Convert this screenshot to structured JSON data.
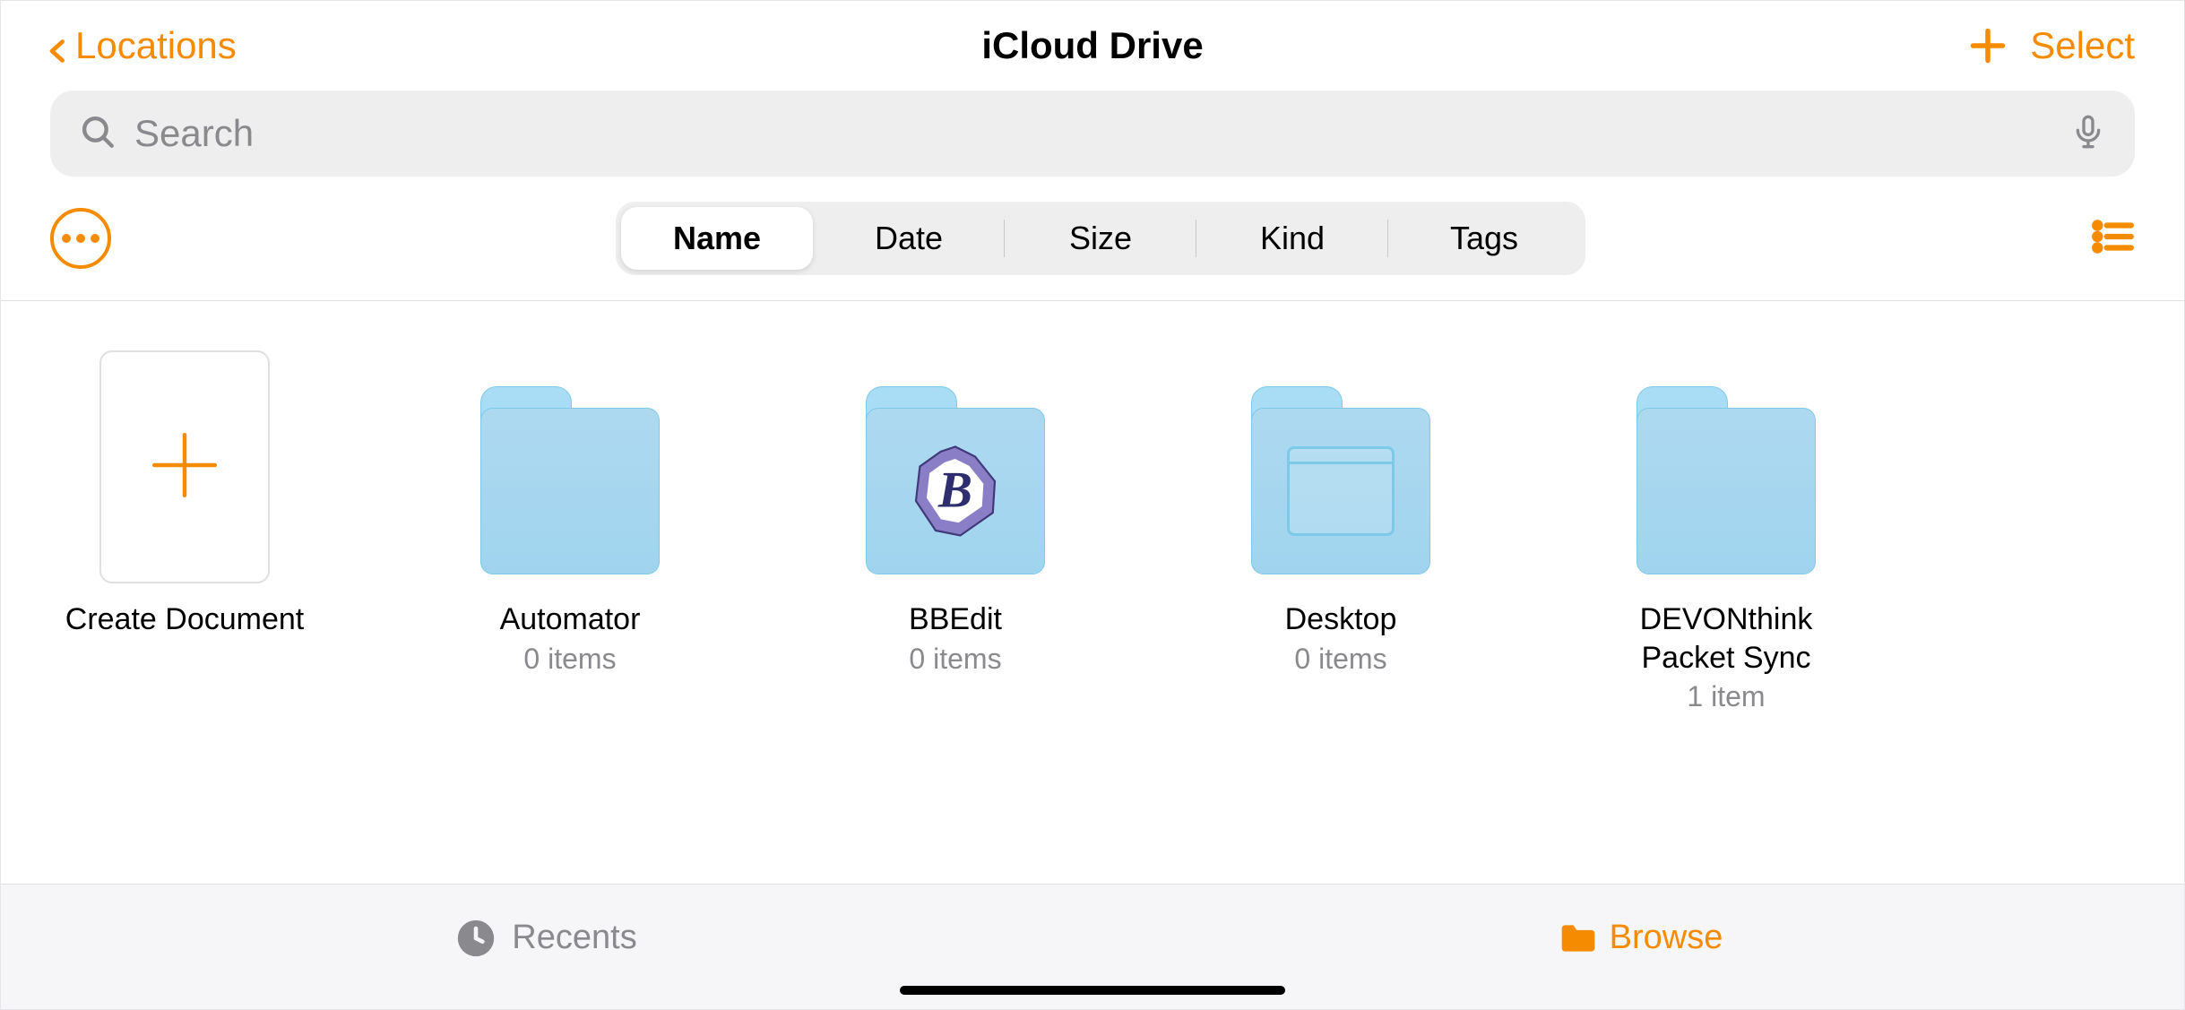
{
  "header": {
    "back_label": "Locations",
    "title": "iCloud Drive",
    "select_label": "Select"
  },
  "search": {
    "placeholder": "Search"
  },
  "sort_segments": [
    "Name",
    "Date",
    "Size",
    "Kind",
    "Tags"
  ],
  "sort_active_index": 0,
  "grid": {
    "create_label": "Create Document",
    "items": [
      {
        "name": "Automator",
        "subtitle": "0 items",
        "overlay": null
      },
      {
        "name": "BBEdit",
        "subtitle": "0 items",
        "overlay": "B"
      },
      {
        "name": "Desktop",
        "subtitle": "0 items",
        "overlay": "window"
      },
      {
        "name": "DEVONthink Packet Sync",
        "subtitle": "1 item",
        "overlay": null
      }
    ]
  },
  "tabbar": {
    "recents_label": "Recents",
    "browse_label": "Browse",
    "active": "browse"
  },
  "colors": {
    "accent": "#f58b00",
    "folder": "#a8ddf5",
    "muted": "#8a8a8e"
  }
}
